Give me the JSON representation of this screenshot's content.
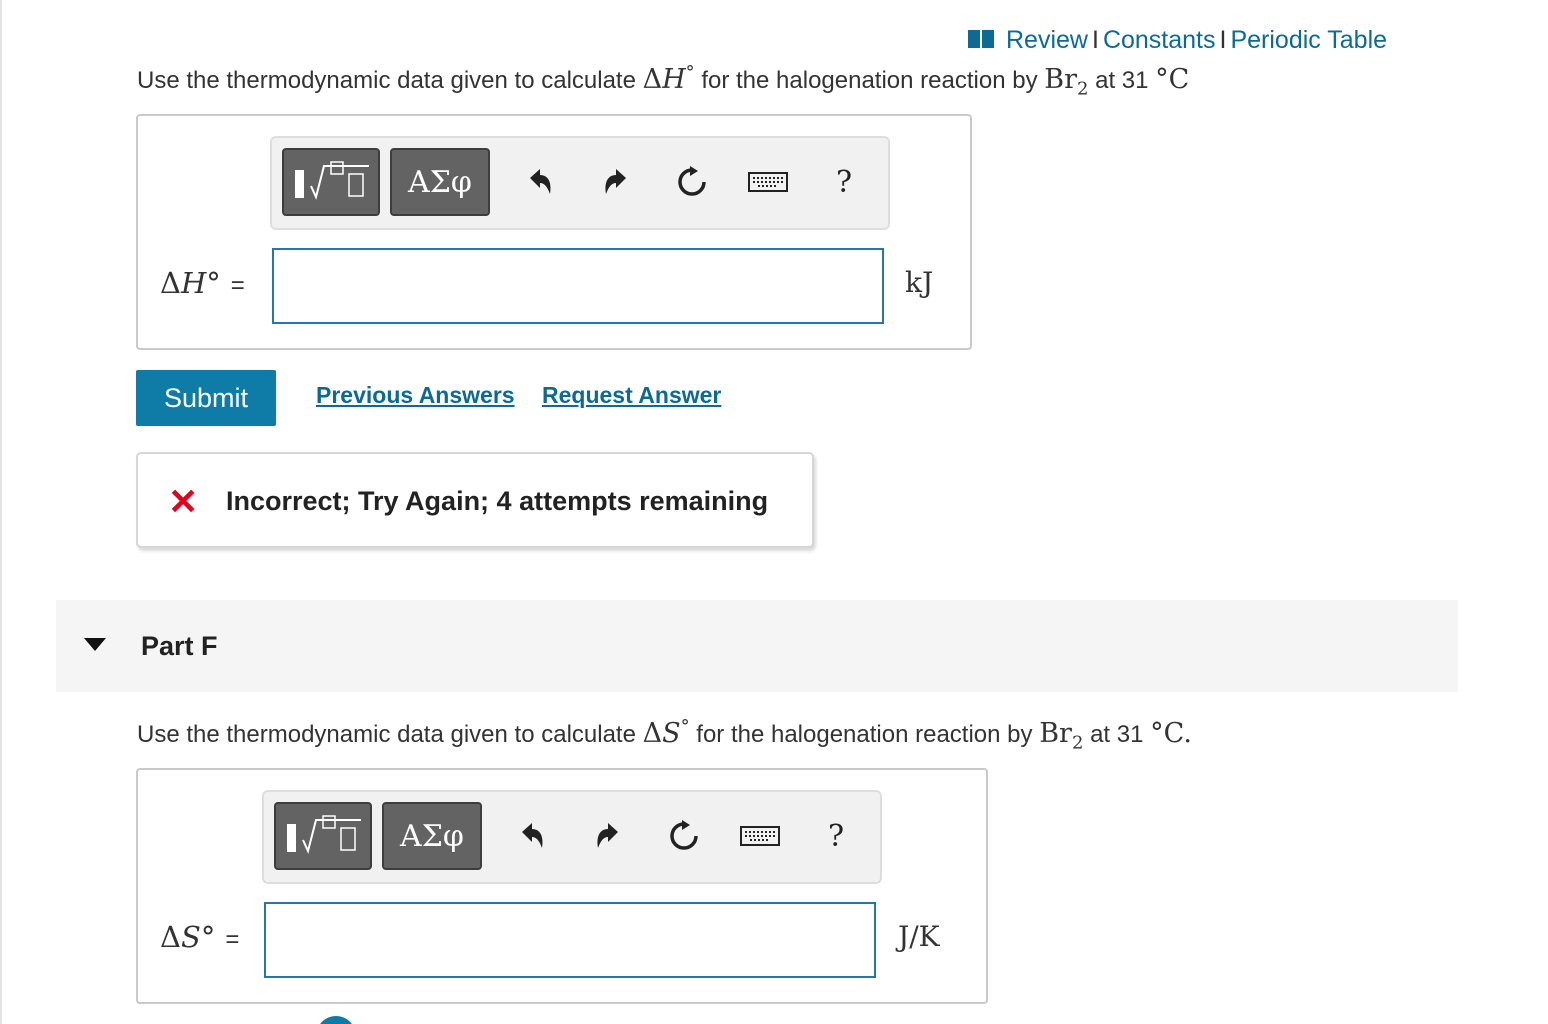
{
  "top_links": {
    "review": "Review",
    "separator": "I",
    "constants": "Constants",
    "periodic_table": "Periodic Table"
  },
  "part_e": {
    "question_prefix": "Use the thermodynamic data given to calculate",
    "quantity_symbol": "H",
    "degree": "°",
    "question_middle": "for the halogenation reaction by",
    "reagent": "Br",
    "reagent_subscript": "2",
    "question_at": "at 31",
    "temp_unit": "°C",
    "toolbar": {
      "greek_label": "ΑΣφ",
      "help_label": "?"
    },
    "label_symbol": "H°",
    "equals": "=",
    "input_value": "",
    "unit": "kJ",
    "submit_label": "Submit",
    "previous_answers_label": "Previous Answers",
    "request_answer_label": "Request Answer",
    "feedback_icon": "✕",
    "feedback_text": "Incorrect; Try Again; 4 attempts remaining"
  },
  "part_f": {
    "title": "Part F",
    "question_prefix": "Use the thermodynamic data given to calculate",
    "quantity_symbol": "S",
    "degree": "°",
    "question_middle": "for the halogenation reaction by",
    "reagent": "Br",
    "reagent_subscript": "2",
    "question_at": "at 31",
    "temp_unit": "°C.",
    "toolbar": {
      "greek_label": "ΑΣφ",
      "help_label": "?"
    },
    "label_symbol": "S°",
    "equals": "=",
    "input_value": "",
    "unit": "J/K"
  },
  "colors": {
    "link": "#0c6a94",
    "submit_bg": "#0e7ca6",
    "input_border": "#2576a9",
    "error": "#e2001a"
  }
}
